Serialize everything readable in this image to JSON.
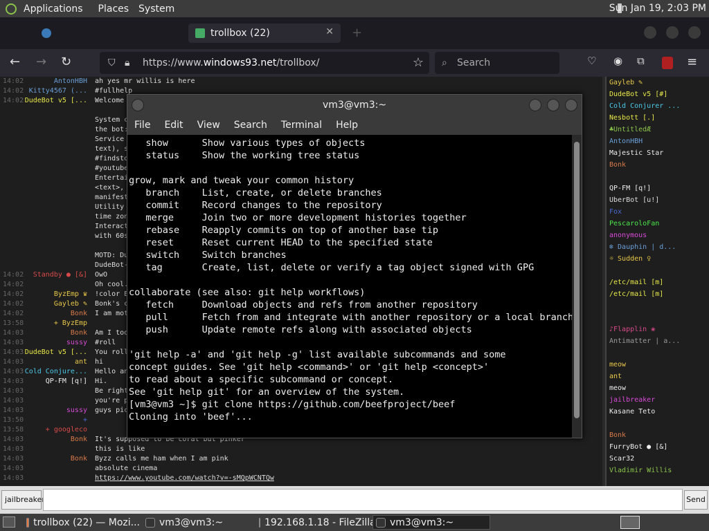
{
  "top_panel": {
    "menus": [
      "Applications",
      "Places",
      "System"
    ],
    "clock": "Sun Jan 19,  2:03 PM"
  },
  "firefox": {
    "tabs": [
      {
        "label": "",
        "active": false
      },
      {
        "label": "trollbox (22)",
        "active": true
      }
    ],
    "url_prefix": "https://www.",
    "url_host": "windows93.net",
    "url_path": "/trollbox/",
    "search_placeholder": "Search"
  },
  "chat": {
    "rows": [
      {
        "time": "14:02",
        "nick": "AntonHBH",
        "nick_color": "#6a9fd8",
        "msg": "ah yes mr willis is here"
      },
      {
        "time": "14:02",
        "nick": "Kitty4567 (...",
        "nick_color": "#6a9fd8",
        "msg": "#fullhelp"
      },
      {
        "time": "14:02",
        "nick": "DudeBot v5 [...",
        "nick_color": "#e8e84a",
        "msg": "Welcome"
      },
      {
        "time": "",
        "nick": "",
        "nick_color": "#ddd",
        "msg": ""
      },
      {
        "time": "",
        "nick": "",
        "nick_color": "#ddd",
        "msg": "System c"
      },
      {
        "time": "",
        "nick": "",
        "nick_color": "#ddd",
        "msg": "the bot:"
      },
      {
        "time": "",
        "nick": "",
        "nick_color": "#ddd",
        "msg": "Service"
      },
      {
        "time": "",
        "nick": "",
        "nick_color": "#ddd",
        "msg": "text), s"
      },
      {
        "time": "",
        "nick": "",
        "nick_color": "#ddd",
        "msg": "#findsto"
      },
      {
        "time": "",
        "nick": "",
        "nick_color": "#ddd",
        "msg": "#youtube"
      },
      {
        "time": "",
        "nick": "",
        "nick_color": "#ddd",
        "msg": "Entertai"
      },
      {
        "time": "",
        "nick": "",
        "nick_color": "#ddd",
        "msg": "<text>,"
      },
      {
        "time": "",
        "nick": "",
        "nick_color": "#ddd",
        "msg": "manifest"
      },
      {
        "time": "",
        "nick": "",
        "nick_color": "#ddd",
        "msg": "Utility"
      },
      {
        "time": "",
        "nick": "",
        "nick_color": "#ddd",
        "msg": "time zon"
      },
      {
        "time": "",
        "nick": "",
        "nick_color": "#ddd",
        "msg": "Interact"
      },
      {
        "time": "",
        "nick": "",
        "nick_color": "#ddd",
        "msg": "with 60s"
      },
      {
        "time": "",
        "nick": "",
        "nick_color": "#ddd",
        "msg": ""
      },
      {
        "time": "",
        "nick": "",
        "nick_color": "#ddd",
        "msg": "MOTD: Du"
      },
      {
        "time": "",
        "nick": "",
        "nick_color": "#ddd",
        "msg": "DudeBot-"
      },
      {
        "time": "14:02",
        "nick": "Standby ● [&]",
        "nick_color": "#d84a4a",
        "msg": "OwO"
      },
      {
        "time": "14:02",
        "nick": "",
        "nick_color": "#4a6ad8",
        "msg": "Oh cool."
      },
      {
        "time": "14:02",
        "nick": "ByzEmp ♛",
        "nick_color": "#e8c84a",
        "msg": "!color E"
      },
      {
        "time": "14:02",
        "nick": "Gayleb ✎",
        "nick_color": "#e8c84a",
        "msg": "Bonk's c"
      },
      {
        "time": "14:02",
        "nick": "Bonk",
        "nick_color": "#d87a4a",
        "msg": "I am mot"
      },
      {
        "time": "13:58",
        "nick": "+ ByzEmp",
        "nick_color": "#e8c84a",
        "msg": ""
      },
      {
        "time": "14:03",
        "nick": "Bonk",
        "nick_color": "#d87a4a",
        "msg": "Am I too"
      },
      {
        "time": "14:03",
        "nick": "sussy",
        "nick_color": "#d84ad8",
        "msg": "#roll"
      },
      {
        "time": "14:03",
        "nick": "DudeBot v5 [...",
        "nick_color": "#e8e84a",
        "msg": "You roll"
      },
      {
        "time": "14:03",
        "nick": "ant",
        "nick_color": "#e8c84a",
        "msg": "hi"
      },
      {
        "time": "14:03",
        "nick": "Cold Conjure...",
        "nick_color": "#4ac8e8",
        "msg": "Hello an"
      },
      {
        "time": "14:03",
        "nick": "QP-FM [q!]",
        "nick_color": "#eee",
        "msg": "Hi."
      },
      {
        "time": "14:03",
        "nick": "",
        "nick_color": "#4a6ad8",
        "msg": "Be right"
      },
      {
        "time": "14:03",
        "nick": "",
        "nick_color": "#d84a4a",
        "msg": "you're p"
      },
      {
        "time": "14:03",
        "nick": "sussy",
        "nick_color": "#d84ad8",
        "msg": "guys pic"
      },
      {
        "time": "13:50",
        "nick": "+",
        "nick_color": "#4a6ad8",
        "msg": ""
      },
      {
        "time": "13:58",
        "nick": "+ googleco",
        "nick_color": "#d84a4a",
        "msg": ""
      },
      {
        "time": "14:03",
        "nick": "Bonk",
        "nick_color": "#d87a4a",
        "msg": "It's supposed to be coral but pinker"
      },
      {
        "time": "14:03",
        "nick": "",
        "nick_color": "#d84a4a",
        "msg": "this is like"
      },
      {
        "time": "14:03",
        "nick": "Bonk",
        "nick_color": "#d87a4a",
        "msg": "Byzz calls me ham when I am pink"
      },
      {
        "time": "14:03",
        "nick": "",
        "nick_color": "#d84a4a",
        "msg": "absolute cinema"
      },
      {
        "time": "14:03",
        "nick": "",
        "nick_color": "#d84a4a",
        "msg": "https://www.youtube.com/watch?v=-sMQpWCNTQw"
      }
    ]
  },
  "userlist": [
    {
      "name": "Gayleb ✎",
      "color": "#e8c84a"
    },
    {
      "name": "DudeBot v5 [#]",
      "color": "#e8e84a"
    },
    {
      "name": "Cold Conjurer ...",
      "color": "#4ac8e8"
    },
    {
      "name": "Nesbott [.]",
      "color": "#e8e84a"
    },
    {
      "name": "♣UntitledÆ",
      "color": "#8ac34a"
    },
    {
      "name": "AntonHBH",
      "color": "#6a9fd8"
    },
    {
      "name": "Majestic Star",
      "color": "#eee"
    },
    {
      "name": "Bonk",
      "color": "#d87a4a"
    },
    {
      "name": "",
      "color": "#4a9a4a"
    },
    {
      "name": "QP-FM [q!]",
      "color": "#eee"
    },
    {
      "name": "UberBot [u!]",
      "color": "#ddd"
    },
    {
      "name": "Fox",
      "color": "#4a6ad8"
    },
    {
      "name": "PescaroloFan",
      "color": "#4ae84a"
    },
    {
      "name": "anonymous",
      "color": "#d84ad8"
    },
    {
      "name": "❄ Dauphin | d...",
      "color": "#6a9fd8"
    },
    {
      "name": "☼ Sudden ♀",
      "color": "#e8c84a"
    },
    {
      "name": "",
      "color": "#4a6ad8"
    },
    {
      "name": "/etc/mail [m]",
      "color": "#e8e84a"
    },
    {
      "name": "/etc/mail [m]",
      "color": "#e8e84a"
    },
    {
      "name": "",
      "color": "#4a4ad8"
    },
    {
      "name": "",
      "color": "#4a9a4a"
    },
    {
      "name": "♪Flapplin ❀",
      "color": "#d84a8a"
    },
    {
      "name": "Antimatter | a...",
      "color": "#999"
    },
    {
      "name": "",
      "color": "#d84a4a"
    },
    {
      "name": "meow",
      "color": "#e8c84a"
    },
    {
      "name": "ant",
      "color": "#e8c84a"
    },
    {
      "name": "meow",
      "color": "#eee"
    },
    {
      "name": "jailbreaker",
      "color": "#d84ad8"
    },
    {
      "name": "Kasane Teto",
      "color": "#eee"
    },
    {
      "name": "",
      "color": "#4a6ad8"
    },
    {
      "name": "Bonk",
      "color": "#d87a4a"
    },
    {
      "name": "FurryBot ● [&]",
      "color": "#eee"
    },
    {
      "name": "Scar32",
      "color": "#eee"
    },
    {
      "name": "Vladimir Willis",
      "color": "#8ac34a"
    }
  ],
  "inputbar": {
    "nick": "jailbreaker",
    "send_label": "Send"
  },
  "terminal": {
    "title": "vm3@vm3:~",
    "menu": [
      "File",
      "Edit",
      "View",
      "Search",
      "Terminal",
      "Help"
    ],
    "lines": [
      "   show      Show various types of objects",
      "   status    Show the working tree status",
      "",
      "grow, mark and tweak your common history",
      "   branch    List, create, or delete branches",
      "   commit    Record changes to the repository",
      "   merge     Join two or more development histories together",
      "   rebase    Reapply commits on top of another base tip",
      "   reset     Reset current HEAD to the specified state",
      "   switch    Switch branches",
      "   tag       Create, list, delete or verify a tag object signed with GPG",
      "",
      "collaborate (see also: git help workflows)",
      "   fetch     Download objects and refs from another repository",
      "   pull      Fetch from and integrate with another repository or a local branch",
      "   push      Update remote refs along with associated objects",
      "",
      "'git help -a' and 'git help -g' list available subcommands and some",
      "concept guides. See 'git help <command>' or 'git help <concept>'",
      "to read about a specific subcommand or concept.",
      "See 'git help git' for an overview of the system.",
      "[vm3@vm3 ~]$ git clone https://github.com/beefproject/beef",
      "Cloning into 'beef'..."
    ]
  },
  "taskbar": {
    "tasks": [
      {
        "label": "trollbox (22) — Mozi...",
        "color": "#e8763a",
        "active": false
      },
      {
        "label": "vm3@vm3:~",
        "color": "#333",
        "active": false
      },
      {
        "label": "192.168.1.18 - FileZilla",
        "color": "#c02020",
        "active": false
      },
      {
        "label": "vm3@vm3:~",
        "color": "#333",
        "active": true
      }
    ]
  }
}
